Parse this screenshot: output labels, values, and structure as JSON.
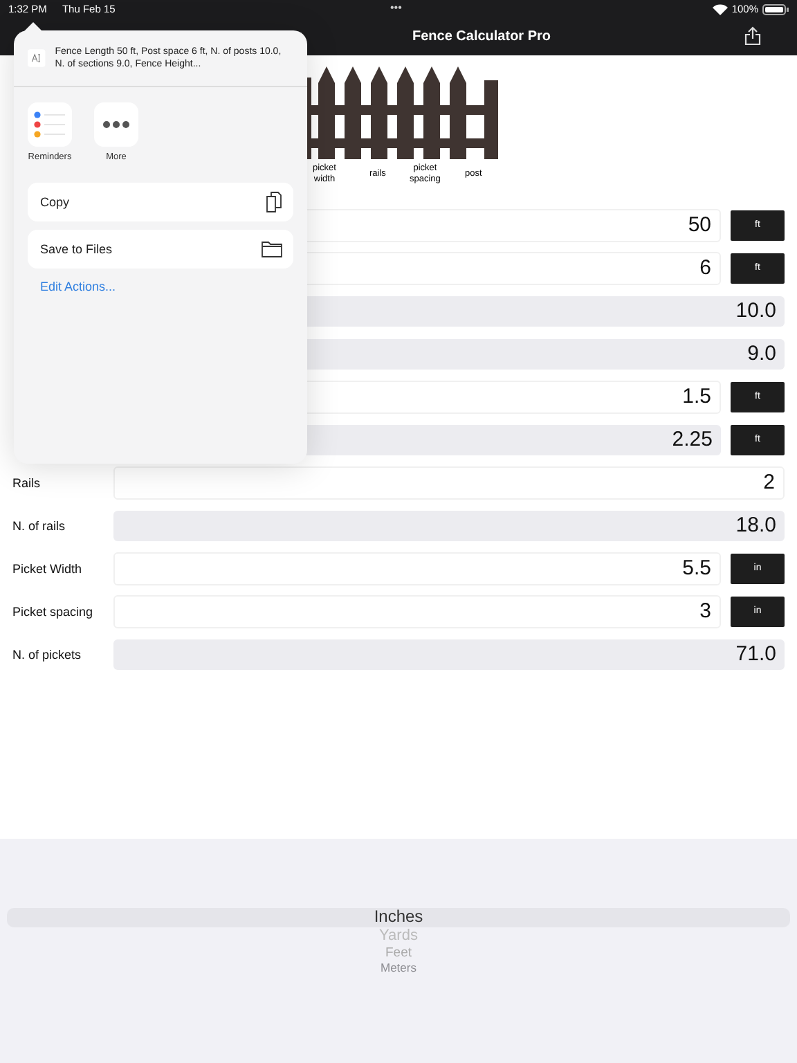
{
  "status_bar": {
    "time": "1:32 PM",
    "date": "Thu Feb 15",
    "dots": "•••",
    "battery": "100%"
  },
  "nav": {
    "title": "Fence Calculator Pro"
  },
  "diagram": {
    "labels": [
      "picket\nwidth",
      "rails",
      "picket\nspacing",
      "post"
    ]
  },
  "rows": [
    {
      "value": "50",
      "editable": true,
      "unit": "ft"
    },
    {
      "value": "6",
      "editable": true,
      "unit": "ft"
    },
    {
      "value": "10.0",
      "editable": false
    },
    {
      "value": "9.0",
      "editable": false
    },
    {
      "value": "1.5",
      "editable": true,
      "unit": "ft"
    },
    {
      "value": "2.25",
      "editable": false,
      "unit": "ft"
    },
    {
      "label": "Rails",
      "value": "2",
      "editable": true
    },
    {
      "label": "N. of rails",
      "value": "18.0",
      "editable": false
    },
    {
      "label": "Picket Width",
      "value": "5.5",
      "editable": true,
      "unit": "in"
    },
    {
      "label": "Picket spacing",
      "value": "3",
      "editable": true,
      "unit": "in"
    },
    {
      "label": "N. of pickets",
      "value": "71.0",
      "editable": false
    }
  ],
  "share_sheet": {
    "preview_text": "Fence Length 50 ft, Post space 6 ft, N. of posts 10.0, N. of sections 9.0, Fence Height...",
    "apps": [
      {
        "kind": "reminders",
        "label": "Reminders"
      },
      {
        "kind": "more",
        "label": "More"
      }
    ],
    "actions": [
      {
        "kind": "copy",
        "label": "Copy"
      },
      {
        "kind": "folder",
        "label": "Save to Files"
      }
    ],
    "edit_link": "Edit Actions..."
  },
  "picker": {
    "items": [
      {
        "label": "Inches",
        "selected": true
      },
      {
        "label": "Yards",
        "selected": false
      },
      {
        "label": "Feet",
        "selected": false
      },
      {
        "label": "Meters",
        "selected": false
      }
    ]
  }
}
